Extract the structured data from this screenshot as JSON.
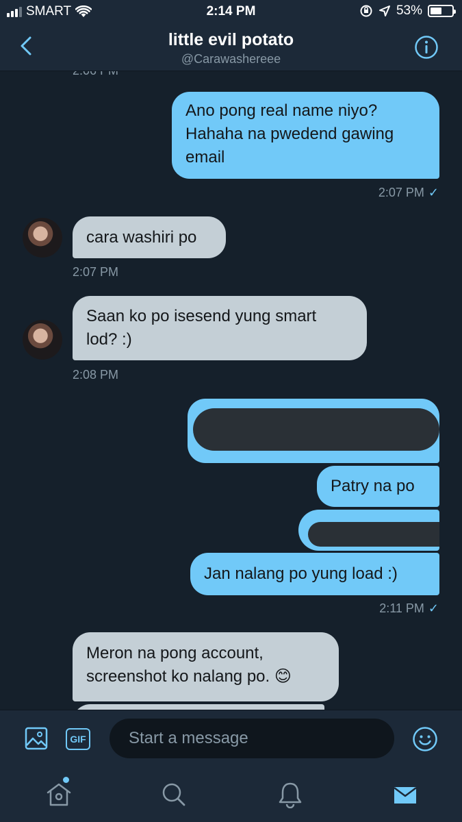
{
  "status_bar": {
    "carrier": "SMART",
    "time": "2:14 PM",
    "battery_percent": "53%",
    "battery_level": 0.53,
    "icons": [
      "signal-icon",
      "wifi-icon",
      "orientation-lock-icon",
      "location-icon",
      "battery-icon"
    ]
  },
  "header": {
    "title": "little evil potato",
    "handle": "@Carawashereee",
    "back_icon": "chevron-left-icon",
    "info_icon": "info-icon"
  },
  "colors": {
    "background": "#15202b",
    "bar": "#1c2938",
    "accent": "#71c9f8",
    "incoming_bubble": "#c4cfd6",
    "outgoing_bubble": "#71c9f8",
    "redaction": "#2a3036",
    "muted_text": "#8899a6"
  },
  "messages": [
    {
      "direction": "outgoing",
      "lines": [
        "Ano pong real name niyo?",
        "Hahaha na pwedend gawing",
        "email"
      ],
      "timestamp": "2:07 PM",
      "read": true
    },
    {
      "direction": "incoming",
      "lines": [
        "cara washiri po"
      ],
      "timestamp": "2:07 PM"
    },
    {
      "direction": "incoming",
      "lines": [
        "Saan ko po isesend yung smart",
        "lod? :)"
      ],
      "timestamp": "2:08 PM"
    },
    {
      "direction": "outgoing",
      "redacted": true
    },
    {
      "direction": "outgoing",
      "lines": [
        "Patry na po"
      ]
    },
    {
      "direction": "outgoing",
      "redacted": true
    },
    {
      "direction": "outgoing",
      "lines": [
        "Jan nalang po yung load :)"
      ],
      "timestamp": "2:11 PM",
      "read": true
    },
    {
      "direction": "incoming",
      "lines": [
        "Meron na pong account,",
        "screenshot ko nalang po. 😊"
      ]
    }
  ],
  "composer": {
    "placeholder": "Start a message",
    "media_icon": "image-icon",
    "gif_label": "GIF",
    "emoji_icon": "emoji-icon"
  },
  "tabbar": {
    "items": [
      "home-icon",
      "search-icon",
      "bell-icon",
      "mail-icon"
    ],
    "active": "mail-icon",
    "home_has_notification_dot": true
  }
}
